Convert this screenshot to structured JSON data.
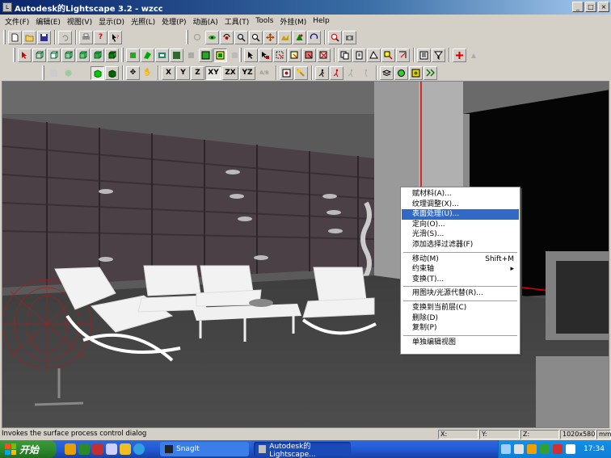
{
  "window": {
    "title": "Autodesk的Lightscape 3.2 - wzcc",
    "minimize": "_",
    "maximize": "□",
    "close": "×"
  },
  "menubar": {
    "items": [
      "文件(F)",
      "编辑(E)",
      "视图(V)",
      "显示(D)",
      "光照(L)",
      "处理(P)",
      "动画(A)",
      "工具(T)",
      "Tools",
      "外挂(M)",
      "Help"
    ]
  },
  "toolbar_axes": {
    "x": "X",
    "y": "Y",
    "z": "Z",
    "xy": "XY",
    "zx": "ZX",
    "yz": "YZ",
    "abc": "A/B"
  },
  "context_menu": {
    "items": [
      {
        "label": "赋材料(A)...",
        "shortcut": "",
        "highlight": false
      },
      {
        "label": "纹理调整(X)...",
        "shortcut": "",
        "highlight": false
      },
      {
        "label": "表面处理(U)...",
        "shortcut": "",
        "highlight": true
      },
      {
        "label": "定向(O)...",
        "shortcut": "",
        "highlight": false
      },
      {
        "label": "光滑(S)...",
        "shortcut": "",
        "highlight": false
      },
      {
        "label": "添加选择过滤器(F)",
        "shortcut": "",
        "highlight": false
      },
      {
        "sep": true
      },
      {
        "label": "移动(M)",
        "shortcut": "Shift+M",
        "highlight": false
      },
      {
        "label": "约束轴",
        "shortcut": "▸",
        "highlight": false
      },
      {
        "label": "变换(T)...",
        "shortcut": "",
        "highlight": false
      },
      {
        "sep": true
      },
      {
        "label": "用图块/光源代替(R)...",
        "shortcut": "",
        "highlight": false
      },
      {
        "sep": true
      },
      {
        "label": "变换到当前层(C)",
        "shortcut": "",
        "highlight": false
      },
      {
        "label": "删除(D)",
        "shortcut": "",
        "highlight": false
      },
      {
        "label": "复制(P)",
        "shortcut": "",
        "highlight": false
      },
      {
        "sep": true
      },
      {
        "label": "单独编辑视图",
        "shortcut": "",
        "highlight": false
      }
    ]
  },
  "statusbar": {
    "message": "Invokes the surface process control dialog",
    "x_label": "X:",
    "y_label": "Y:",
    "z_label": "Z:",
    "resolution": "1020x580",
    "units": "mm"
  },
  "taskbar": {
    "start": "开始",
    "tasks": [
      "SnagIt",
      "Autodesk的Lightscape..."
    ],
    "clock": "17:34"
  },
  "colors": {
    "title_gradient_start": "#0a246a",
    "highlight": "#316ac5",
    "taskbar": "#245edb",
    "start_button": "#2e8b2e"
  }
}
